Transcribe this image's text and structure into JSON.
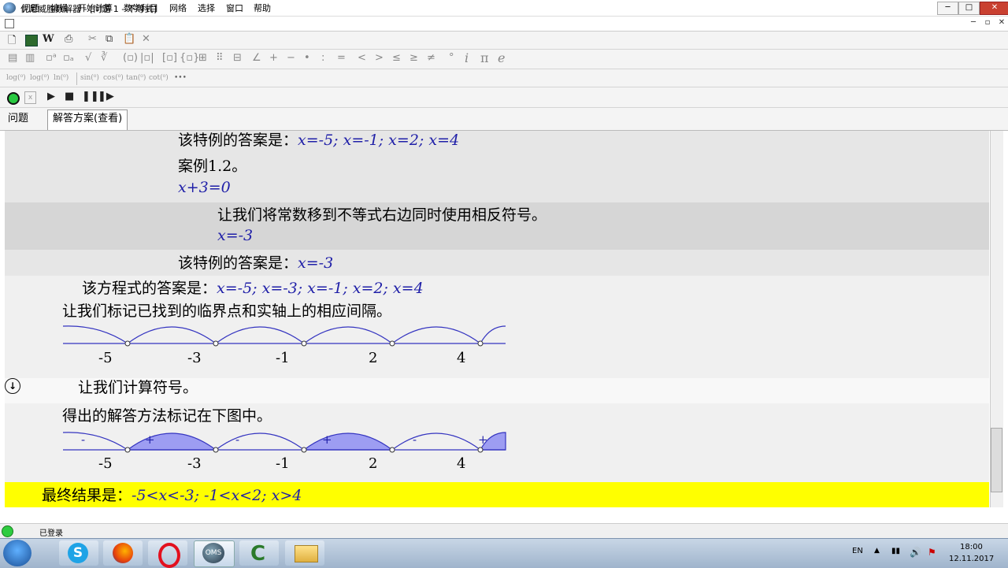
{
  "window": {
    "title": "优尼威胜数解器 - [问题 1 - 不等式]",
    "minimize": "─",
    "maximize": "□",
    "close": "✕"
  },
  "menu": {
    "items": [
      "问题",
      "编辑",
      "开始计算",
      "数学科目",
      "网络",
      "选择",
      "窗口",
      "帮助"
    ],
    "mdi": [
      "─",
      "▫",
      "✕"
    ]
  },
  "toolbar3": {
    "funcs": [
      "log(⁰)",
      "log(⁰)",
      "ln(⁰)",
      "sin(⁰)",
      "cos(⁰)",
      "tan(⁰)",
      "cot(⁰)",
      "•••"
    ]
  },
  "tabs": {
    "problem": "问题",
    "solution": "解答方案(查看)"
  },
  "content": {
    "line1_prefix": "该特例的答案是：",
    "line1_math": "x=-5; x=-1; x=2; x=4",
    "line2": "案例1.2。",
    "line3_math": "x+3=0",
    "line4": "让我们将常数移到不等式右边同时使用相反符号。",
    "line5_math": "x=-3",
    "line6_prefix": "该特例的答案是：",
    "line6_math": "x=-3",
    "line7_prefix": "该方程式的答案是：",
    "line7_math": "x=-5; x=-3; x=-1; x=2; x=4",
    "line8": "让我们标记已找到的临界点和实轴上的相应间隔。",
    "line9": "让我们计算符号。",
    "line10": "得出的解答方法标记在下图中。",
    "final_prefix": "最终结果是：",
    "final_math": "-5<x<-3; -1<x<2; x>4"
  },
  "numberline": {
    "points": [
      "-5",
      "-3",
      "-1",
      "2",
      "4"
    ],
    "signs": [
      "-",
      "+",
      "-",
      "+",
      "-",
      "+"
    ],
    "accent": "#3434c0",
    "fill": "#9d9df2"
  },
  "status": {
    "text": "已登录"
  },
  "tray": {
    "lang": "EN",
    "time": "18:00",
    "date": "12.11.2017"
  }
}
